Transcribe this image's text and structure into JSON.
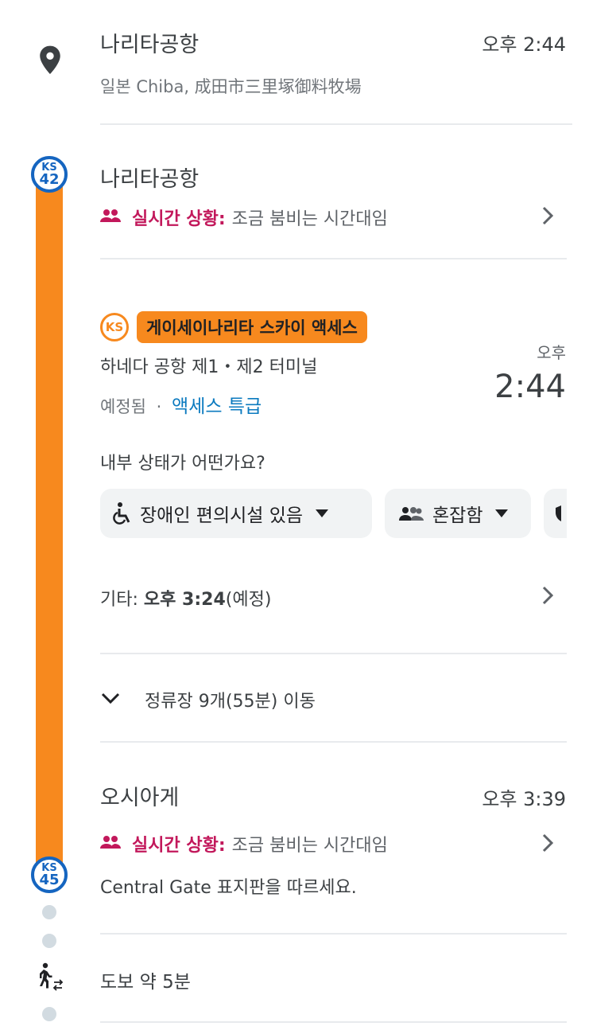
{
  "origin": {
    "name": "나리타공항",
    "address": "일본 Chiba, 成田市三里塚御料牧場",
    "time": "오후 2:44"
  },
  "stop_start": {
    "badge_line": "KS",
    "badge_number": "42",
    "name": "나리타공항",
    "live_label": "실시간 상황:",
    "live_text": "조금 붐비는 시간대임"
  },
  "train": {
    "logo": "KS",
    "line_name": "게이세이나리타 스카이 액세스",
    "destination": "하네다 공항 제1・제2 터미널",
    "status": "예정됨",
    "separator": "·",
    "service": "액세스 특급",
    "time_label": "오후",
    "time": "2:44",
    "question": "내부 상태가 어떤가요?",
    "chips": [
      {
        "label": "장애인 편의시설 있음",
        "icon": "wheelchair-icon"
      },
      {
        "label": "혼잡함",
        "icon": "people-icon"
      }
    ],
    "other_label": "기타:",
    "other_time": "오후 3:24",
    "other_suffix": "(예정)",
    "stops_summary": "정류장 9개(55분) 이동"
  },
  "stop_end": {
    "badge_line": "KS",
    "badge_number": "45",
    "name": "오시아게",
    "time": "오후 3:39",
    "live_label": "실시간 상황:",
    "live_text": "조금 붐비는 시간대임",
    "instruction": "Central Gate 표지판을 따르세요."
  },
  "walk": {
    "text": "도보 약 5분",
    "icon": "walking-icon"
  },
  "colors": {
    "line_orange": "#f7891e",
    "badge_blue": "#1565c0",
    "live_pink": "#c2185b",
    "service_blue": "#1a73e8"
  }
}
